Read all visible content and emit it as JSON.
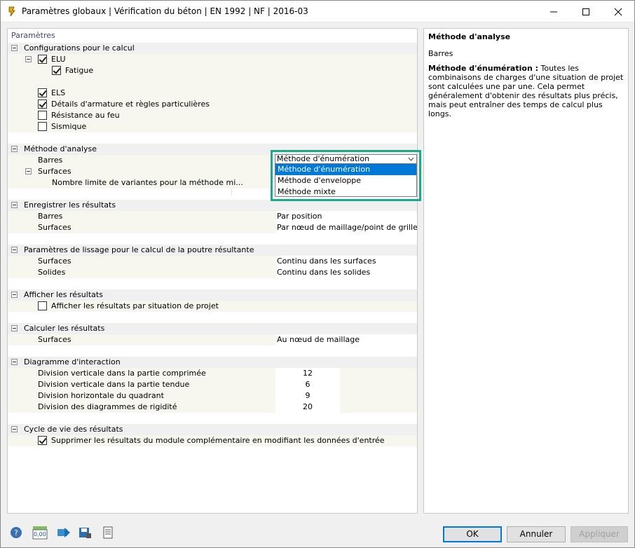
{
  "window": {
    "title": "Paramètres globaux | Vérification du béton | EN 1992 | NF | 2016-03"
  },
  "panel": {
    "header": "Paramètres"
  },
  "groups": {
    "calc": "Configurations pour le calcul",
    "elu": "ELU",
    "fatigue": "Fatigue",
    "els": "ELS",
    "details": "Détails d'armature et règles particulières",
    "feu": "Résistance au feu",
    "sismique": "Sismique",
    "methode": "Méthode d'analyse",
    "barres": "Barres",
    "surfaces": "Surfaces",
    "nombre": "Nombre limite de variantes pour la méthode mi...",
    "enreg": "Enregistrer les résultats",
    "enreg_barres": "Barres",
    "enreg_barres_val": "Par position",
    "enreg_surf": "Surfaces",
    "enreg_surf_val": "Par nœud de maillage/point de grille",
    "lissage": "Paramètres de lissage pour le calcul de la poutre résultante",
    "liss_surf": "Surfaces",
    "liss_surf_val": "Continu dans les surfaces",
    "liss_sol": "Solides",
    "liss_sol_val": "Continu dans les solides",
    "afficher": "Afficher les résultats",
    "afficher_cb": "Afficher les résultats par situation de projet",
    "calculer": "Calculer les résultats",
    "calc_surf": "Surfaces",
    "calc_surf_val": "Au nœud de maillage",
    "diagramme": "Diagramme d'interaction",
    "div1": "Division verticale dans la partie comprimée",
    "div1_val": "12",
    "div2": "Division verticale dans la partie tendue",
    "div2_val": "6",
    "div3": "Division horizontale du quadrant",
    "div3_val": "9",
    "div4": "Division des diagrammes de rigidité",
    "div4_val": "20",
    "cycle": "Cycle de vie des résultats",
    "cycle_cb": "Supprimer les résultats du module complémentaire en modifiant les données d'entrée"
  },
  "checks": {
    "elu": true,
    "fatigue": true,
    "els": true,
    "details": true,
    "feu": false,
    "sismique": false,
    "afficher": false,
    "cycle": true
  },
  "dropdown": {
    "value": "Méthode d'énumération",
    "options": [
      "Méthode d'énumération",
      "Méthode d'enveloppe",
      "Méthode mixte"
    ],
    "selected": 0
  },
  "info": {
    "title": "Méthode d'analyse",
    "subtitle": "Barres",
    "bold": "Méthode d'énumération :",
    "text": " Toutes les combinaisons de charges d'une situation de projet sont calculées une par une. Cela permet généralement d'obtenir des résultats plus précis, mais peut entraîner des temps de calcul plus longs."
  },
  "buttons": {
    "ok": "OK",
    "cancel": "Annuler",
    "apply": "Appliquer"
  },
  "toolbar_value": "0,00",
  "colors": {
    "accent": "#1aab8a",
    "selection": "#0078d7"
  }
}
